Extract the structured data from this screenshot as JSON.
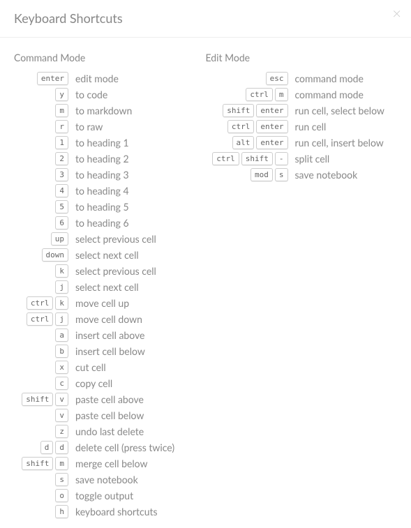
{
  "title": "Keyboard Shortcuts",
  "close_glyph": "×",
  "command_mode_label": "Command Mode",
  "edit_mode_label": "Edit Mode",
  "command_shortcuts": [
    {
      "keys": [
        "enter"
      ],
      "desc": "edit mode"
    },
    {
      "keys": [
        "y"
      ],
      "desc": "to code"
    },
    {
      "keys": [
        "m"
      ],
      "desc": "to markdown"
    },
    {
      "keys": [
        "r"
      ],
      "desc": "to raw"
    },
    {
      "keys": [
        "1"
      ],
      "desc": "to heading 1"
    },
    {
      "keys": [
        "2"
      ],
      "desc": "to heading 2"
    },
    {
      "keys": [
        "3"
      ],
      "desc": "to heading 3"
    },
    {
      "keys": [
        "4"
      ],
      "desc": "to heading 4"
    },
    {
      "keys": [
        "5"
      ],
      "desc": "to heading 5"
    },
    {
      "keys": [
        "6"
      ],
      "desc": "to heading 6"
    },
    {
      "keys": [
        "up"
      ],
      "desc": "select previous cell"
    },
    {
      "keys": [
        "down"
      ],
      "desc": "select next cell"
    },
    {
      "keys": [
        "k"
      ],
      "desc": "select previous cell"
    },
    {
      "keys": [
        "j"
      ],
      "desc": "select next cell"
    },
    {
      "keys": [
        "ctrl",
        "k"
      ],
      "desc": "move cell up"
    },
    {
      "keys": [
        "ctrl",
        "j"
      ],
      "desc": "move cell down"
    },
    {
      "keys": [
        "a"
      ],
      "desc": "insert cell above"
    },
    {
      "keys": [
        "b"
      ],
      "desc": "insert cell below"
    },
    {
      "keys": [
        "x"
      ],
      "desc": "cut cell"
    },
    {
      "keys": [
        "c"
      ],
      "desc": "copy cell"
    },
    {
      "keys": [
        "shift",
        "v"
      ],
      "desc": "paste cell above"
    },
    {
      "keys": [
        "v"
      ],
      "desc": "paste cell below"
    },
    {
      "keys": [
        "z"
      ],
      "desc": "undo last delete"
    },
    {
      "keys": [
        "d",
        "d"
      ],
      "desc": "delete cell (press twice)"
    },
    {
      "keys": [
        "shift",
        "m"
      ],
      "desc": "merge cell below"
    },
    {
      "keys": [
        "s"
      ],
      "desc": "save notebook"
    },
    {
      "keys": [
        "o"
      ],
      "desc": "toggle output"
    },
    {
      "keys": [
        "h"
      ],
      "desc": "keyboard shortcuts"
    }
  ],
  "edit_shortcuts": [
    {
      "keys": [
        "esc"
      ],
      "desc": "command mode"
    },
    {
      "keys": [
        "ctrl",
        "m"
      ],
      "desc": "command mode"
    },
    {
      "keys": [
        "shift",
        "enter"
      ],
      "desc": "run cell, select below"
    },
    {
      "keys": [
        "ctrl",
        "enter"
      ],
      "desc": "run cell"
    },
    {
      "keys": [
        "alt",
        "enter"
      ],
      "desc": "run cell, insert below"
    },
    {
      "keys": [
        "ctrl",
        "shift",
        "-"
      ],
      "desc": "split cell"
    },
    {
      "keys": [
        "mod",
        "s"
      ],
      "desc": "save notebook"
    }
  ]
}
